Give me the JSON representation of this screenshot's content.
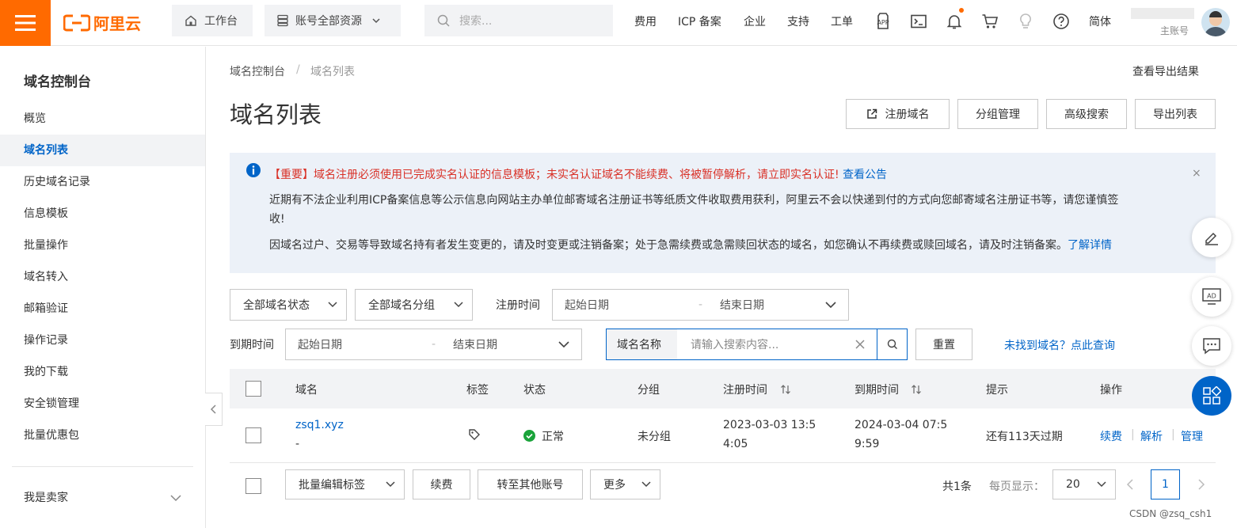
{
  "header": {
    "logo_text": "阿里云",
    "workbench": "工作台",
    "resources": "账号全部资源",
    "search_placeholder": "搜索...",
    "nav": [
      "费用",
      "ICP 备案",
      "企业",
      "支持",
      "工单"
    ],
    "lang": "简体",
    "account_label": "主账号"
  },
  "sidebar": {
    "title": "域名控制台",
    "items": [
      "概览",
      "域名列表",
      "历史域名记录",
      "信息模板",
      "批量操作",
      "域名转入",
      "邮箱验证",
      "操作记录",
      "我的下载",
      "安全锁管理",
      "批量优惠包"
    ],
    "active_index": 1,
    "seller": "我是卖家"
  },
  "breadcrumb": {
    "root": "域名控制台",
    "sep": "/",
    "current": "域名列表"
  },
  "export_results": "查看导出结果",
  "page_title": "域名列表",
  "actions": {
    "register": "注册域名",
    "group": "分组管理",
    "advanced": "高级搜索",
    "export": "导出列表"
  },
  "notice": {
    "important": "【重要】域名注册必须使用已完成实名认证的信息模板；未实名认证域名不能续费、将被暂停解析，请立即实名认证!",
    "announcement_link": "查看公告",
    "line2a": "近期有不法企业利用ICP备案信息等公示信息向网站主办单位邮寄域名注册证书等纸质文件收取费用获利，阿里云不会以快递到付的方式向您邮寄域名注册证书等，请您谨慎签",
    "line2b": "收!",
    "line3": "因域名过户、交易等导致域名持有者发生变更的，请及时变更或注销备案；处于急需续费或急需赎回状态的域名，如您确认不再续费或赎回域名，请及时注销备案。",
    "details_link": "了解详情",
    "close": "×"
  },
  "filters": {
    "status": "全部域名状态",
    "group": "全部域名分组",
    "reg_time_label": "注册时间",
    "exp_time_label": "到期时间",
    "start_date": "起始日期",
    "end_date": "结束日期",
    "range_sep": "-",
    "search_type": "域名名称",
    "search_placeholder": "请输入搜索内容...",
    "reset": "重置",
    "not_found": "未找到域名？点此查询"
  },
  "table": {
    "headers": {
      "domain": "域名",
      "tag": "标签",
      "status": "状态",
      "group": "分组",
      "reg_time": "注册时间",
      "exp_time": "到期时间",
      "hint": "提示",
      "ops": "操作"
    },
    "rows": [
      {
        "domain": "zsq1.xyz",
        "sub": "-",
        "status": "正常",
        "group": "未分组",
        "reg_time_1": "2023-03-03 13:5",
        "reg_time_2": "4:05",
        "exp_time_1": "2024-03-04 07:5",
        "exp_time_2": "9:59",
        "hint": "还有113天过期",
        "ops": [
          "续费",
          "解析",
          "管理"
        ]
      }
    ]
  },
  "footer": {
    "batch_tag": "批量编辑标签",
    "renew": "续费",
    "transfer": "转至其他账号",
    "more": "更多",
    "total": "共1条",
    "per_page_label": "每页显示：",
    "per_page": "20",
    "page": "1"
  },
  "watermark": "CSDN @zsq_csh1",
  "colors": {
    "brand": "#ff6a00",
    "link": "#0064c8",
    "success": "#1aa33a",
    "notice_bg": "#ecf1f8",
    "danger": "#d93026"
  }
}
